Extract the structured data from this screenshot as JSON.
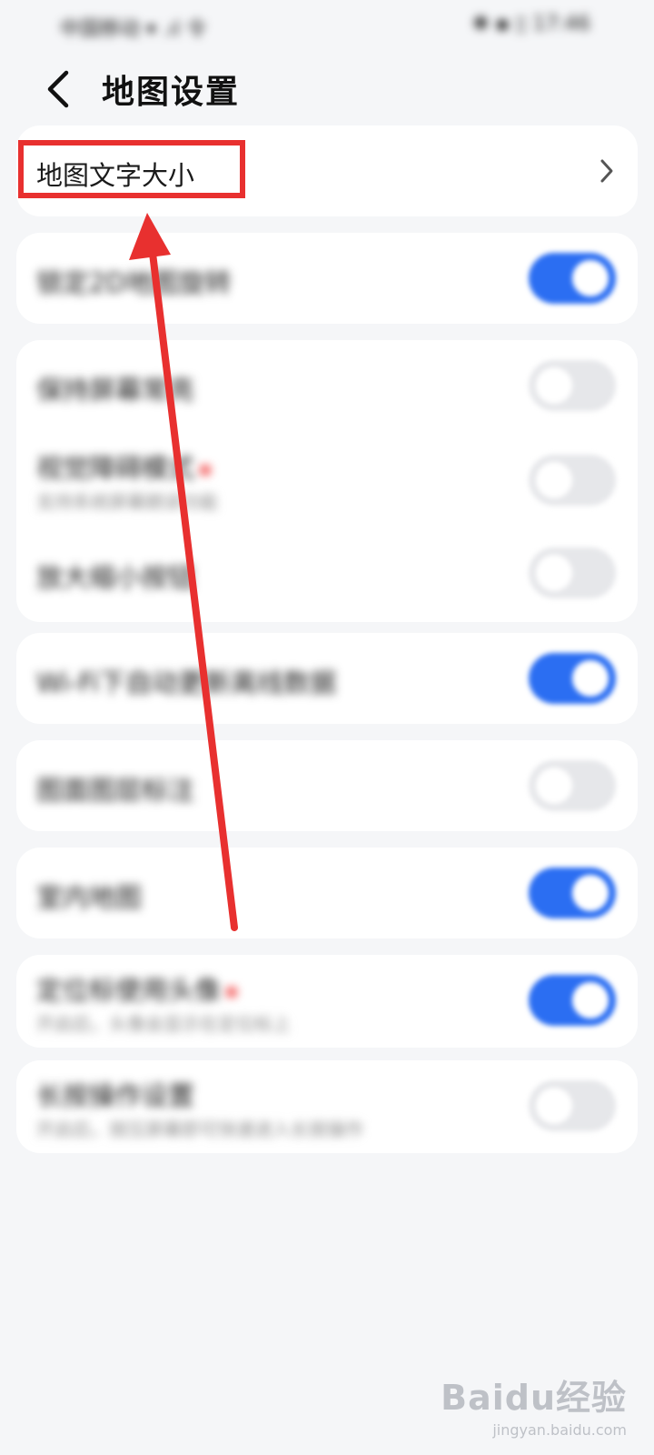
{
  "status_bar": {
    "left": "中国移动 ▾ .ıl 令",
    "right": "✱ ▪ ▯ 17:46"
  },
  "header": {
    "title": "地图设置"
  },
  "rows": {
    "map_text_size": {
      "label": "地图文字大小"
    },
    "lock_2d": {
      "label": "锁定2D地图旋转",
      "state": "on"
    },
    "keep_screen_on": {
      "label": "保持屏幕常亮",
      "state": "off"
    },
    "eye_mode": {
      "label": "视觉障碍模式",
      "sub": "支持系统屏幕朗读功能",
      "state": "off"
    },
    "zoom_button": {
      "label": "放大缩小按钮",
      "state": "off"
    },
    "wifi_update": {
      "label": "Wi-Fi下自动更新离线数据",
      "state": "on"
    },
    "map_marks": {
      "label": "图面图层标注",
      "state": "off"
    },
    "indoor_map": {
      "label": "室内地图",
      "state": "on"
    },
    "location_avatar": {
      "label": "定位标使用头像",
      "sub": "开启后，头像会显示在定位标上",
      "state": "on"
    },
    "long_press": {
      "label": "长按操作设置",
      "sub": "开启后，按压屏幕即可快速进入长按操作",
      "state": "off"
    }
  },
  "watermark": {
    "logo": "Baidu经验",
    "sub": "jingyan.baidu.com"
  },
  "colors": {
    "toggle_on": "#2b6ef2",
    "toggle_off": "#e6e7ea",
    "highlight": "#e8302f",
    "background": "#f5f6f8"
  },
  "icons": {
    "back": "chevron-left-icon",
    "row_arrow": "chevron-right-icon"
  }
}
